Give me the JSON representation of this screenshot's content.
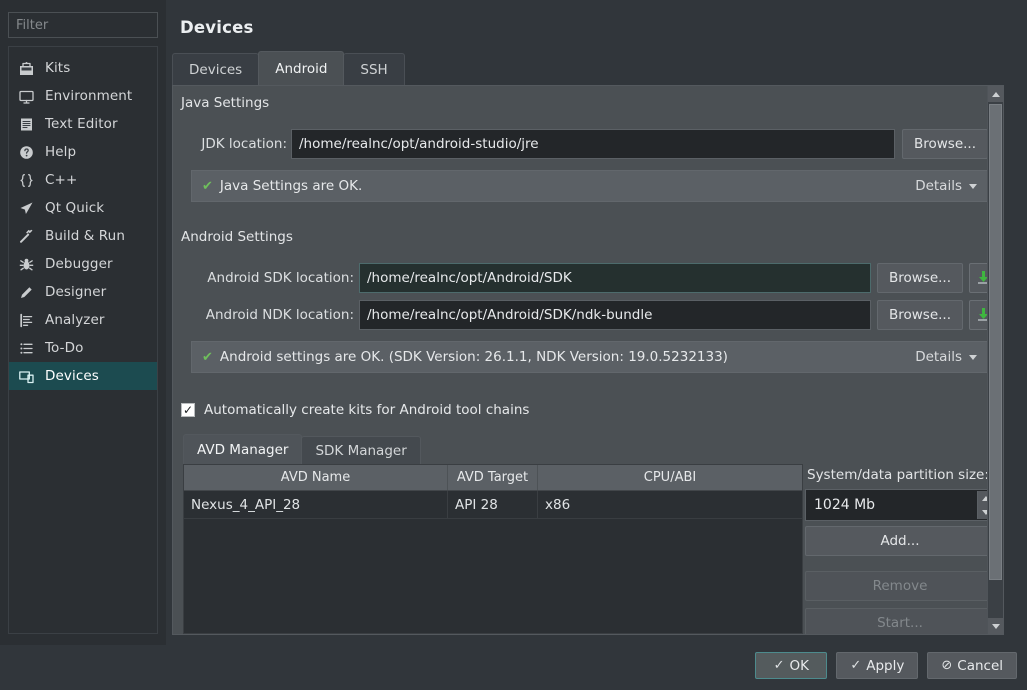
{
  "sidebar": {
    "filter": {
      "placeholder": "Filter",
      "value": ""
    },
    "items": [
      {
        "label": "Kits",
        "icon": "kits-icon",
        "selected": false
      },
      {
        "label": "Environment",
        "icon": "monitor-icon",
        "selected": false
      },
      {
        "label": "Text Editor",
        "icon": "document-icon",
        "selected": false
      },
      {
        "label": "Help",
        "icon": "question-circle-icon",
        "selected": false
      },
      {
        "label": "C++",
        "icon": "braces-icon",
        "selected": false
      },
      {
        "label": "Qt Quick",
        "icon": "paper-plane-icon",
        "selected": false
      },
      {
        "label": "Build & Run",
        "icon": "hammer-icon",
        "selected": false
      },
      {
        "label": "Debugger",
        "icon": "bug-icon",
        "selected": false
      },
      {
        "label": "Designer",
        "icon": "pencil-icon",
        "selected": false
      },
      {
        "label": "Analyzer",
        "icon": "analyzer-icon",
        "selected": false
      },
      {
        "label": "To-Do",
        "icon": "list-icon",
        "selected": false
      },
      {
        "label": "Devices",
        "icon": "devices-icon",
        "selected": true
      }
    ]
  },
  "header": {
    "title": "Devices"
  },
  "tabs": [
    {
      "label": "Devices",
      "active": false
    },
    {
      "label": "Android",
      "active": true
    },
    {
      "label": "SSH",
      "active": false
    }
  ],
  "java_settings": {
    "group_title": "Java Settings",
    "jdk_label": "JDK location:",
    "jdk_value": "/home/realnc/opt/android-studio/jre",
    "browse_label": "Browse...",
    "status_text": "Java Settings are OK.",
    "status_check": "✔",
    "details_label": "Details"
  },
  "android_settings": {
    "group_title": "Android Settings",
    "sdk_label": "Android SDK location:",
    "sdk_value": "/home/realnc/opt/Android/SDK",
    "ndk_label": "Android NDK location:",
    "ndk_value": "/home/realnc/opt/Android/SDK/ndk-bundle",
    "browse_label": "Browse...",
    "download_icon": "download-icon",
    "status_text": "Android settings are OK. (SDK Version: 26.1.1, NDK Version: 19.0.5232133)",
    "status_check": "✔",
    "details_label": "Details"
  },
  "auto_kits": {
    "label": "Automatically create kits for Android tool chains",
    "checked": true,
    "check_glyph": "✓"
  },
  "inner_tabs": [
    {
      "label": "AVD Manager",
      "active": true
    },
    {
      "label": "SDK Manager",
      "active": false
    }
  ],
  "avd_table": {
    "columns": [
      "AVD Name",
      "AVD Target",
      "CPU/ABI"
    ],
    "rows": [
      {
        "name": "Nexus_4_API_28",
        "target": "API 28",
        "cpu_abi": "x86"
      }
    ]
  },
  "avd_side": {
    "partition_label": "System/data partition size:",
    "partition_value": "1024 Mb",
    "add_label": "Add...",
    "remove_label": "Remove",
    "start_label": "Start...",
    "remove_disabled": true,
    "start_disabled": true
  },
  "dialog_buttons": [
    {
      "label": "OK",
      "icon": "check-icon",
      "glyph": "✓",
      "default": true
    },
    {
      "label": "Apply",
      "icon": "check-icon",
      "glyph": "✓",
      "default": false
    },
    {
      "label": "Cancel",
      "icon": "no-entry-icon",
      "glyph": "⊘",
      "default": false
    }
  ],
  "colors": {
    "accent_teal": "#1c4b50",
    "status_green": "#6fbf5c",
    "panel_bg": "#4b5054",
    "window_bg": "#31363b",
    "sidebar_bg": "#2b2f33",
    "field_bg": "#232629"
  }
}
